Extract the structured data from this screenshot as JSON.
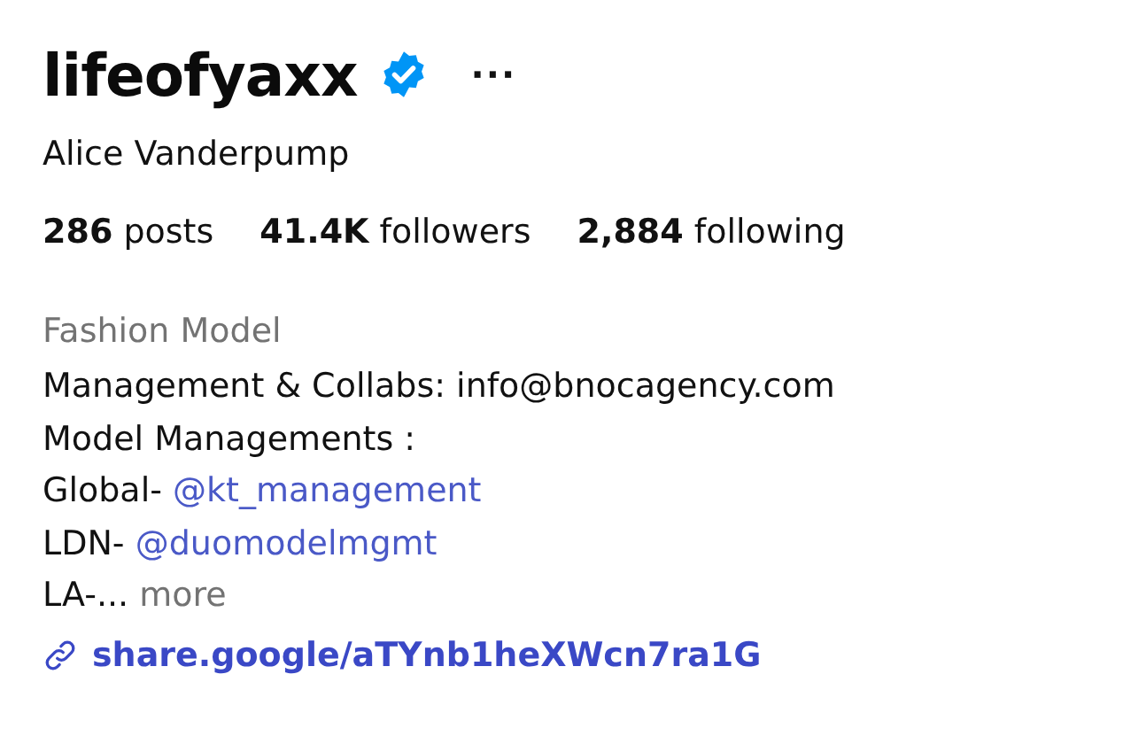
{
  "profile": {
    "username": "lifeofyaxx",
    "verified": true,
    "more_menu": "···",
    "full_name": "Alice Vanderpump"
  },
  "stats": [
    "**286** posts",
    "**41.4K** followers",
    "**2,884** following"
  ],
  "bio": {
    "category": "Fashion Model",
    "lines": [
      {
        "text": "Management & Collabs: info@bnocagency.com"
      },
      {
        "text": "Model Managements :"
      },
      {
        "text": "Global-",
        "mention": "@kt_management"
      },
      {
        "text": "LDN-",
        "mention": "@duomodelmgmt"
      },
      {
        "text": "LA-...",
        "more": "more"
      }
    ],
    "link": "share.google/aTYnb1heXWcn7ra1G"
  }
}
